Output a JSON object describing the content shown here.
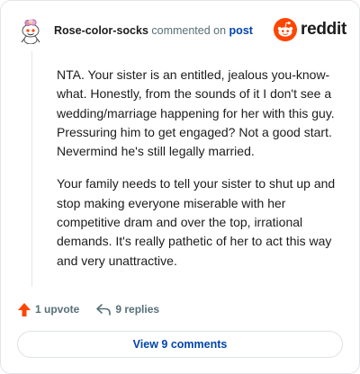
{
  "header": {
    "username": "Rose-color-socks",
    "action_text": " commented on ",
    "post_link": "post",
    "avatar_icon": "snoo-avatar-icon",
    "logo_icon": "reddit-logo-icon",
    "logo_text": "reddit"
  },
  "comment": {
    "paragraphs": [
      "NTA. Your sister is an entitled, jealous you-know-what. Honestly, from the sounds of it I don't see a wedding/marriage happening for her with this guy. Pressuring him to get engaged? Not a good start. Nevermind he's still legally married.",
      "Your family needs to tell your sister to shut up and stop making everyone miserable with her competitive dram and over the top, irrational demands. It's really pathetic of her to act this way and very unattractive."
    ]
  },
  "actions": {
    "upvote_label": "1 upvote",
    "upvote_icon": "upvote-arrow-icon",
    "replies_label": "9 replies",
    "replies_icon": "reply-arrow-icon"
  },
  "footer": {
    "view_comments_label": "View 9 comments"
  },
  "colors": {
    "reddit_orange": "#ff4500",
    "link_blue": "#0045ac",
    "muted_text": "#576f76"
  }
}
